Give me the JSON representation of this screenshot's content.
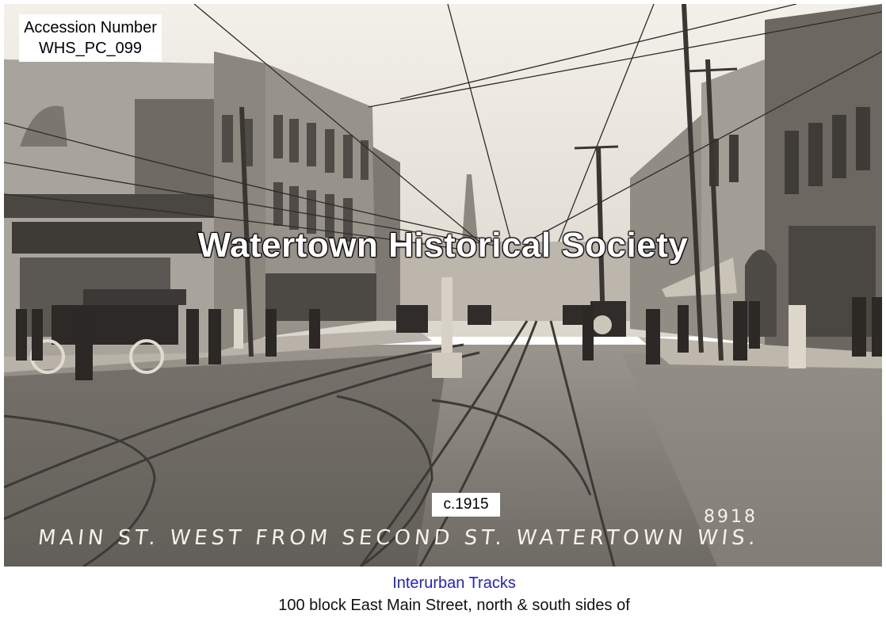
{
  "accession": {
    "line1": "Accession Number",
    "line2": "WHS_PC_099"
  },
  "watermark": "Watertown Historical Society",
  "date_label": "c.1915",
  "photo_caption": "MAIN ST. WEST FROM SECOND ST. WATERTOWN WIS.",
  "plate_number": "8918",
  "subject": "Interurban Tracks",
  "description": "100 block East Main Street, north & south sides of",
  "colors": {
    "sepia_light": "#e9e4da",
    "sepia_dark": "#3b3835",
    "subject_blue": "#2323cc"
  }
}
